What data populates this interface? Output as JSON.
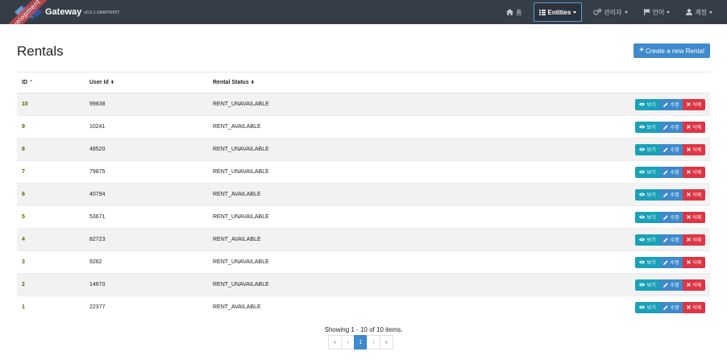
{
  "navbar": {
    "ribbon": "Development",
    "brand_title": "Gateway",
    "brand_version": "v0.0.1-SNAPSHOT",
    "items": [
      {
        "label": "홈",
        "icon": "home-icon"
      },
      {
        "label": "Entities",
        "icon": "list-icon"
      },
      {
        "label": "관리자",
        "icon": "cogs-icon"
      },
      {
        "label": "언어",
        "icon": "flag-icon"
      },
      {
        "label": "계정",
        "icon": "user-icon"
      }
    ]
  },
  "page": {
    "title": "Rentals",
    "create_label": "Create a new Rental",
    "create_plus": "+"
  },
  "table": {
    "headers": {
      "id": "ID",
      "user_id": "User Id",
      "status": "Rental Status"
    },
    "sort": {
      "asc": "⌃",
      "both": "⬍"
    },
    "actions": {
      "view": "보기",
      "edit": "수정",
      "delete": "삭제"
    },
    "rows": [
      {
        "id": "10",
        "user_id": "99838",
        "status": "RENT_UNAVAILABLE"
      },
      {
        "id": "9",
        "user_id": "10241",
        "status": "RENT_AVAILABLE"
      },
      {
        "id": "8",
        "user_id": "48520",
        "status": "RENT_UNAVAILABLE"
      },
      {
        "id": "7",
        "user_id": "79875",
        "status": "RENT_UNAVAILABLE"
      },
      {
        "id": "6",
        "user_id": "40794",
        "status": "RENT_AVAILABLE"
      },
      {
        "id": "5",
        "user_id": "53671",
        "status": "RENT_UNAVAILABLE"
      },
      {
        "id": "4",
        "user_id": "82723",
        "status": "RENT_AVAILABLE"
      },
      {
        "id": "3",
        "user_id": "9282",
        "status": "RENT_UNAVAILABLE"
      },
      {
        "id": "2",
        "user_id": "14670",
        "status": "RENT_UNAVAILABLE"
      },
      {
        "id": "1",
        "user_id": "22377",
        "status": "RENT_AVAILABLE"
      }
    ]
  },
  "pagination": {
    "summary": "Showing 1 - 10 of 10 items.",
    "links": [
      "«",
      "‹",
      "1",
      "›",
      "»"
    ],
    "active": "1"
  },
  "colors": {
    "navbar": "#353d47",
    "primary": "#3e8acc",
    "info": "#1aa1b8",
    "danger": "#dc3545",
    "ribbon": "#c5494f"
  }
}
